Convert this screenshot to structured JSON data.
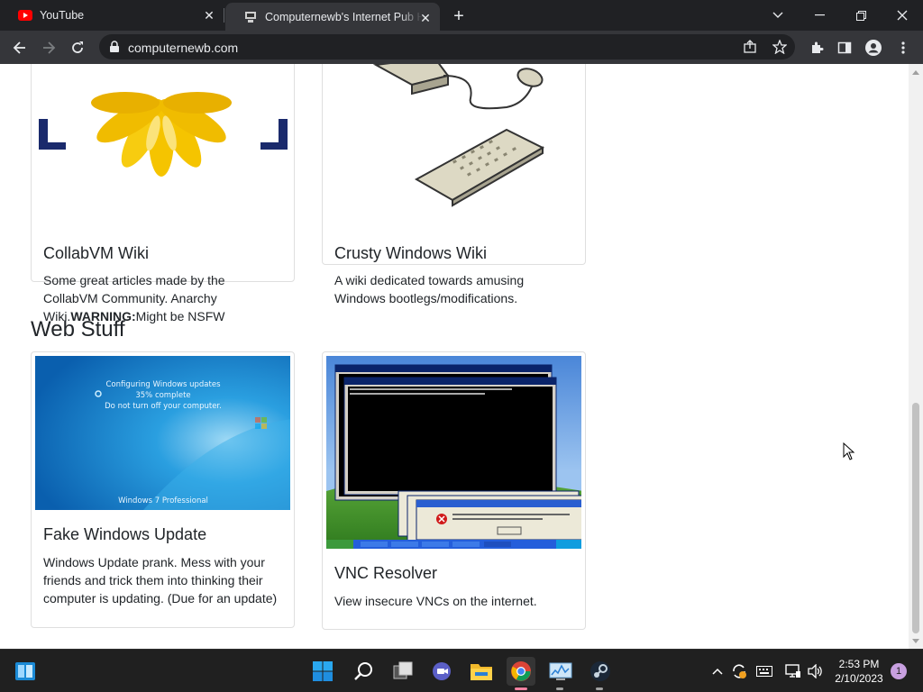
{
  "browser": {
    "tabs": [
      {
        "title": "YouTube",
        "active": false,
        "icon": "youtube-icon"
      },
      {
        "title": "Computernewb's Internet Pub Hub",
        "active": true,
        "icon": "computer-favicon"
      }
    ],
    "url": "computernewb.com"
  },
  "page": {
    "top_cards": [
      {
        "title": "CollabVM Wiki",
        "text_before": "Some great articles made by the CollabVM Community. Anarchy Wiki.",
        "warning": "WARNING:",
        "text_after": "Might be NSFW"
      },
      {
        "title": "Crusty Windows Wiki",
        "text": "A wiki dedicated towards amusing Windows bootlegs/modifications."
      }
    ],
    "web_stuff": {
      "heading": "Web Stuff",
      "cards": [
        {
          "title": "Fake Windows Update",
          "text": "Windows Update prank. Mess with your friends and trick them into thinking their computer is updating. (Due for an update)",
          "image": {
            "line1": "Configuring Windows updates",
            "line2": "35% complete",
            "line3": "Do not turn off your computer.",
            "brand": "Windows 7 Professional"
          }
        },
        {
          "title": "VNC Resolver",
          "text": "View insecure VNCs on the internet."
        }
      ]
    }
  },
  "taskbar": {
    "time": "2:53 PM",
    "date": "2/10/2023",
    "notifications": "1"
  },
  "colors": {
    "chrome_dark": "#202124",
    "chrome_toolbar": "#35363a",
    "taskbar": "#202020",
    "text": "#212529"
  }
}
